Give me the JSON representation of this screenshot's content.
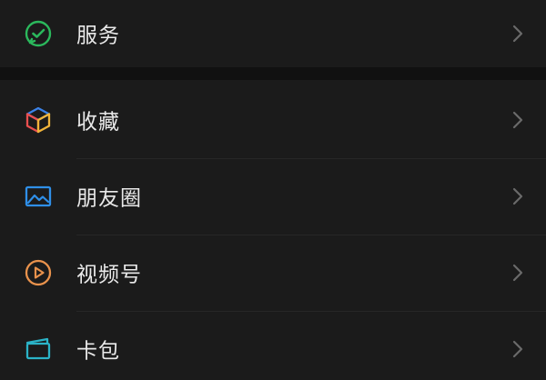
{
  "menu": {
    "services": {
      "label": "服务",
      "icon": "wechat-pay-icon",
      "color": "#2bb85c"
    },
    "favorites": {
      "label": "收藏",
      "icon": "cube-icon",
      "colors": [
        "#3b82e8",
        "#e94f4f",
        "#f1b43a"
      ]
    },
    "moments": {
      "label": "朋友圈",
      "icon": "photo-icon",
      "color": "#2f8fe8"
    },
    "channels": {
      "label": "视频号",
      "icon": "play-circle-icon",
      "color": "#e9924c"
    },
    "cards": {
      "label": "卡包",
      "icon": "card-wallet-icon",
      "color": "#2bb3c7"
    }
  },
  "theme": {
    "background": "#1b1b1b",
    "section_gap": "#111111",
    "text": "#e9e9e9",
    "chevron": "#6a6a6a"
  }
}
